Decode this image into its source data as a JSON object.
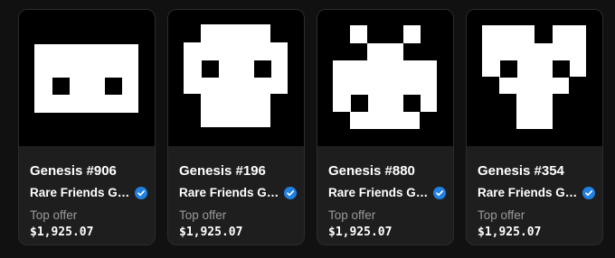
{
  "cards": [
    {
      "title": "Genesis #906",
      "collection": "Rare Friends Genesis",
      "offer_label": "Top offer",
      "offer_value": "$1,925.07",
      "verified_icon": "verified-badge-icon"
    },
    {
      "title": "Genesis #196",
      "collection": "Rare Friends Genesis",
      "offer_label": "Top offer",
      "offer_value": "$1,925.07",
      "verified_icon": "verified-badge-icon"
    },
    {
      "title": "Genesis #880",
      "collection": "Rare Friends Genesis",
      "offer_label": "Top offer",
      "offer_value": "$1,925.07",
      "verified_icon": "verified-badge-icon"
    },
    {
      "title": "Genesis #354",
      "collection": "Rare Friends Genesis",
      "offer_label": "Top offer",
      "offer_value": "$1,925.07",
      "verified_icon": "verified-badge-icon"
    }
  ],
  "colors": {
    "page_background": "#111111",
    "card_background": "#1e1e1e",
    "art_background": "#000000",
    "art_foreground": "#ffffff",
    "verified_badge": "#2081e2",
    "muted_text": "#9a9a9a"
  }
}
